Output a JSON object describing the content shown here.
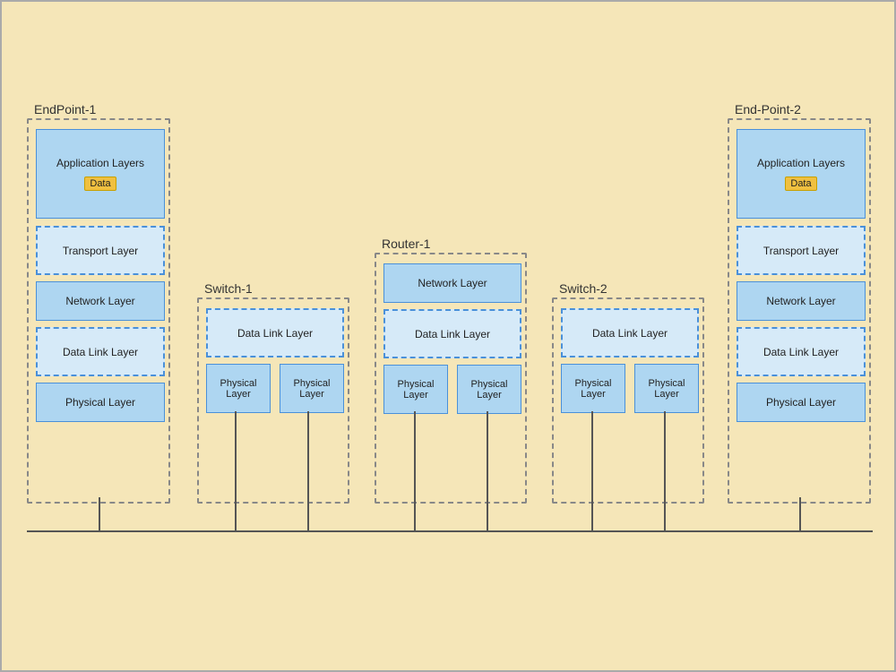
{
  "background": "#f5e6b8",
  "devices": {
    "endpoint1": {
      "label": "EndPoint-1",
      "layers": {
        "application": "Application Layers",
        "data": "Data",
        "transport": "Transport Layer",
        "network": "Network Layer",
        "datalink": "Data Link Layer",
        "physical": "Physical Layer"
      }
    },
    "switch1": {
      "label": "Switch-1",
      "layers": {
        "datalink": "Data Link Layer",
        "physical1": "Physical Layer",
        "physical2": "Physical Layer"
      }
    },
    "router1": {
      "label": "Router-1",
      "layers": {
        "network": "Network Layer",
        "datalink": "Data Link Layer",
        "physical1": "Physical Layer",
        "physical2": "Physical Layer"
      }
    },
    "switch2": {
      "label": "Switch-2",
      "layers": {
        "datalink": "Data Link Layer",
        "physical1": "Physical Layer",
        "physical2": "Physical Layer"
      }
    },
    "endpoint2": {
      "label": "End-Point-2",
      "layers": {
        "application": "Application Layers",
        "data": "Data",
        "transport": "Transport Layer",
        "network": "Network Layer",
        "datalink": "Data Link Layer",
        "physical": "Physical Layer"
      }
    }
  }
}
